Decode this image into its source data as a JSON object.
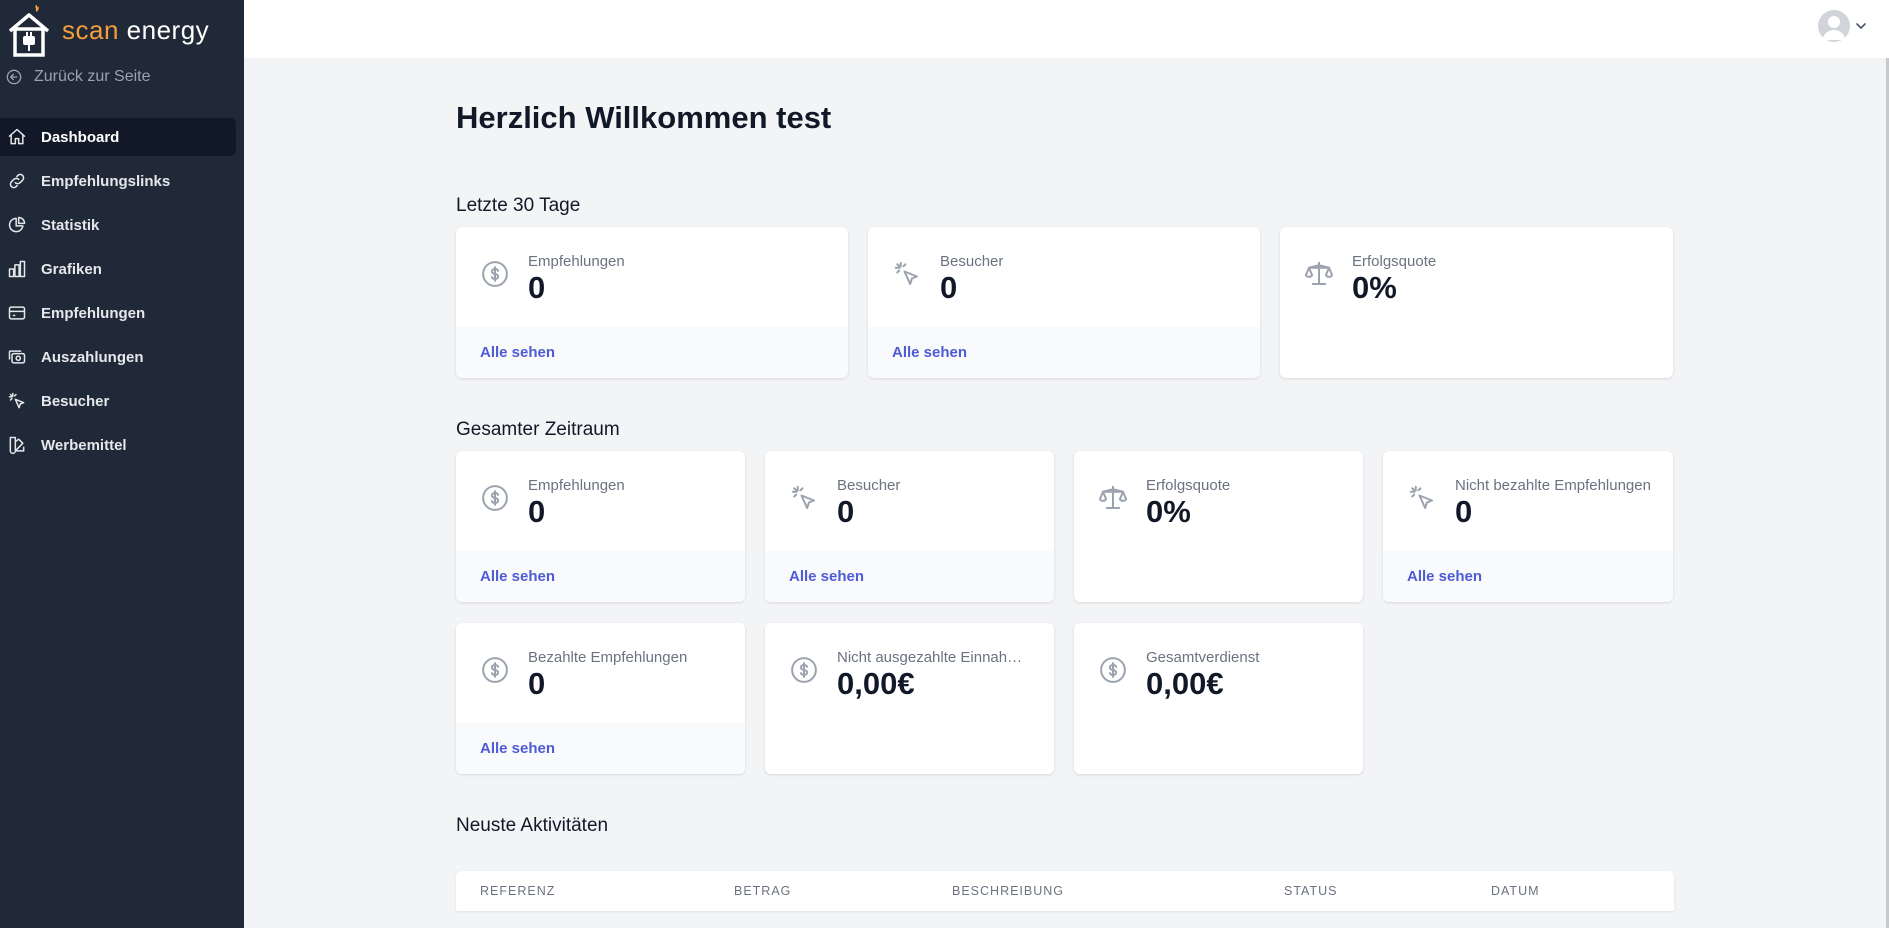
{
  "brand": {
    "part1": "scan ",
    "part2": "energy"
  },
  "back_link": "Zurück zur Seite",
  "nav": [
    {
      "label": "Dashboard",
      "icon": "home-icon",
      "active": true
    },
    {
      "label": "Empfehlungslinks",
      "icon": "link-icon"
    },
    {
      "label": "Statistik",
      "icon": "pie-chart-icon"
    },
    {
      "label": "Grafiken",
      "icon": "bar-chart-icon"
    },
    {
      "label": "Empfehlungen",
      "icon": "credit-card-icon"
    },
    {
      "label": "Auszahlungen",
      "icon": "cash-icon"
    },
    {
      "label": "Besucher",
      "icon": "cursor-click-icon"
    },
    {
      "label": "Werbemittel",
      "icon": "color-swatch-icon"
    }
  ],
  "page_title": "Herzlich Willkommen test",
  "sections": {
    "last30": "Letzte 30 Tage",
    "total": "Gesamter Zeitraum",
    "activity": "Neuste Aktivitäten"
  },
  "last30_cards": [
    {
      "label": "Empfehlungen",
      "value": "0",
      "link": "Alle sehen",
      "icon": "currency-dollar-icon"
    },
    {
      "label": "Besucher",
      "value": "0",
      "link": "Alle sehen",
      "icon": "cursor-click-icon"
    },
    {
      "label": "Erfolgsquote",
      "value": "0%",
      "icon": "scale-icon"
    }
  ],
  "total_cards": [
    {
      "label": "Empfehlungen",
      "value": "0",
      "link": "Alle sehen",
      "icon": "currency-dollar-icon"
    },
    {
      "label": "Besucher",
      "value": "0",
      "link": "Alle sehen",
      "icon": "cursor-click-icon"
    },
    {
      "label": "Erfolgsquote",
      "value": "0%",
      "icon": "scale-icon"
    },
    {
      "label": "Nicht bezahlte Empfehlungen",
      "value": "0",
      "link": "Alle sehen",
      "icon": "cursor-click-icon"
    },
    {
      "label": "Bezahlte Empfehlungen",
      "value": "0",
      "link": "Alle sehen",
      "icon": "currency-dollar-icon"
    },
    {
      "label": "Nicht ausgezahlte Einnahmen",
      "value": "0,00€",
      "icon": "currency-dollar-icon"
    },
    {
      "label": "Gesamtverdienst",
      "value": "0,00€",
      "icon": "currency-dollar-icon"
    }
  ],
  "activity_table": {
    "columns": [
      "Referenz",
      "Betrag",
      "Beschreibung",
      "Status",
      "Datum"
    ]
  },
  "colors": {
    "sidebar": "#1f2937",
    "accent": "#4f5bd5",
    "brand_orange": "#f59e3c"
  }
}
